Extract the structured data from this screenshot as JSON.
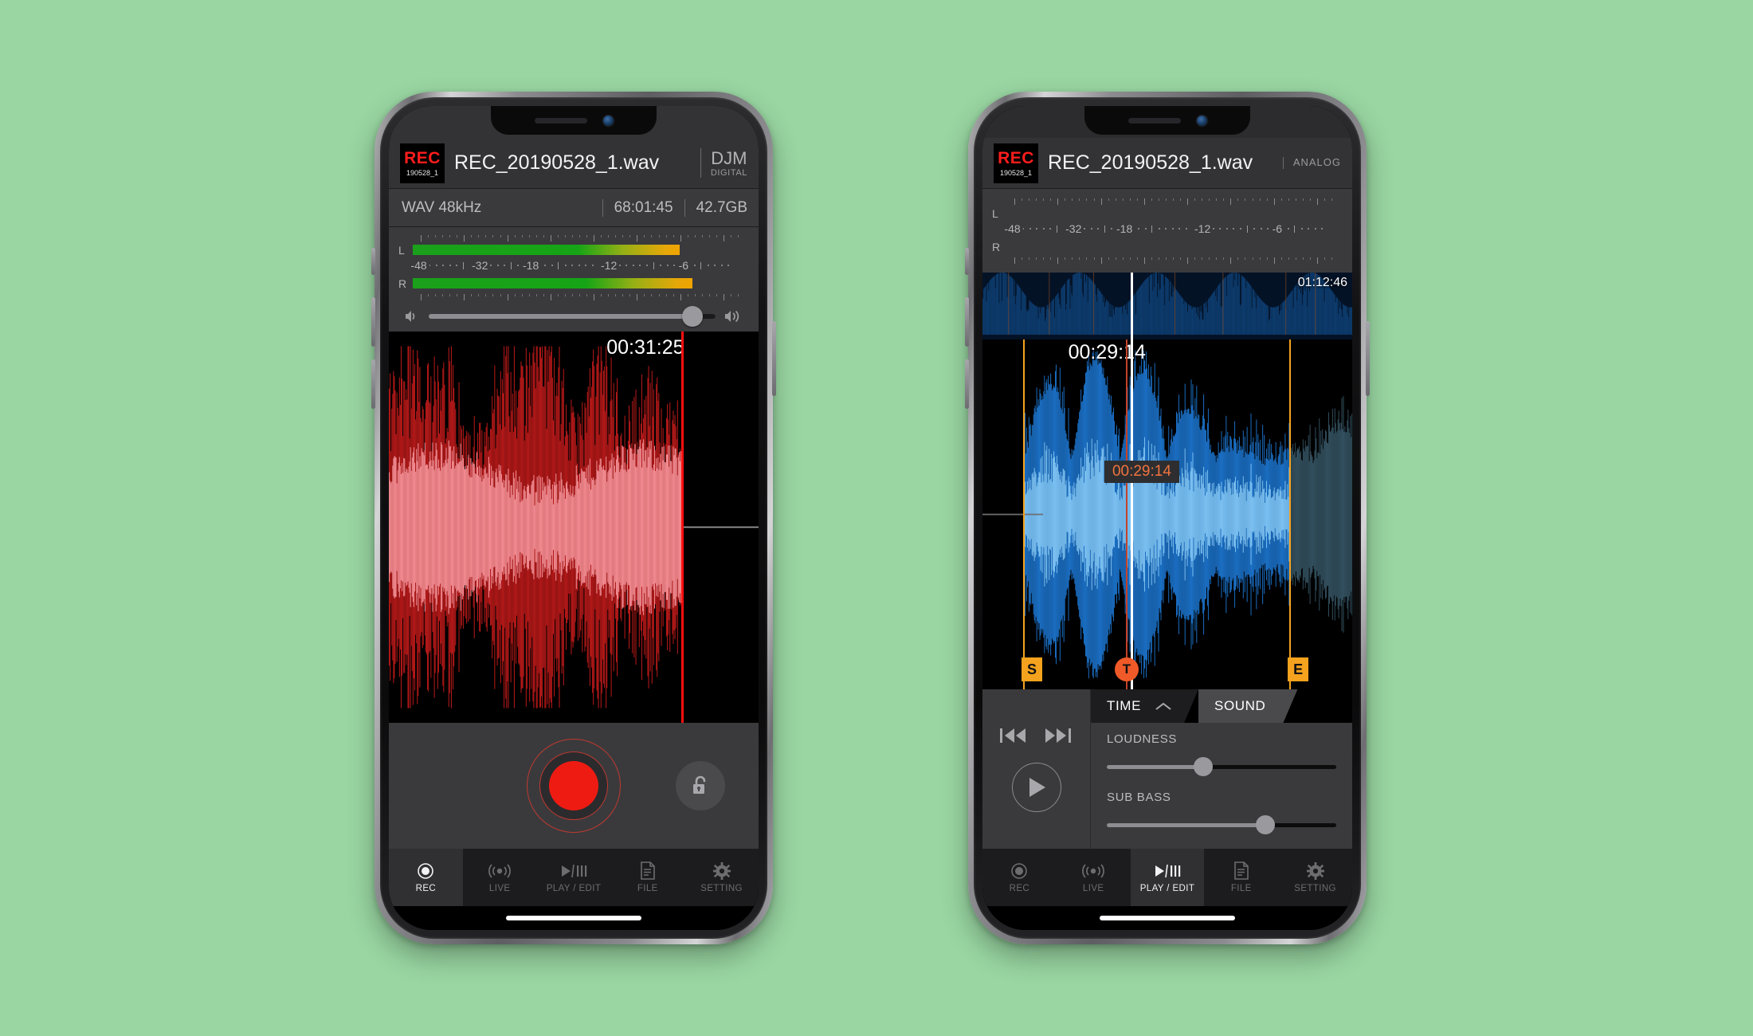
{
  "background_color": "#99d6a2",
  "phones": [
    {
      "id": "rec-screen",
      "mode_tag": {
        "line1": "DJM",
        "line2": "DIGITAL"
      },
      "badge": {
        "title": "REC",
        "subtitle": "190528_1"
      },
      "filename": "REC_20190528_1.wav",
      "info": {
        "format": "WAV 48kHz",
        "remaining": "68:01:45",
        "storage": "42.7GB"
      },
      "meters": {
        "left_label": "L",
        "right_label": "R",
        "scale_labels": [
          "-48",
          "-32",
          "-18",
          "-12",
          "-6"
        ],
        "left_level_pct": 82,
        "right_level_pct": 86
      },
      "volume": {
        "value_pct": 92,
        "icon_left": "speaker-low-icon",
        "icon_right": "speaker-high-icon"
      },
      "waveform": {
        "color_peak": "#b01818",
        "color_body": "#ef8a90",
        "playhead_color": "#ff0f0f",
        "current_time": "00:31:25",
        "position_pct": 79
      },
      "record": {
        "button_label": "record-button",
        "lock_label": "unlock-button"
      },
      "nav": {
        "items": [
          {
            "label": "REC",
            "icon": "record-circle-icon",
            "active": true
          },
          {
            "label": "LIVE",
            "icon": "broadcast-icon",
            "active": false
          },
          {
            "label": "PLAY / EDIT",
            "icon": "play-edit-icon",
            "active": false
          },
          {
            "label": "FILE",
            "icon": "document-icon",
            "active": false
          },
          {
            "label": "SETTING",
            "icon": "gear-icon",
            "active": false
          }
        ]
      }
    },
    {
      "id": "play-edit-screen",
      "mode_tag": {
        "line1": "ANALOG",
        "line2": ""
      },
      "badge": {
        "title": "REC",
        "subtitle": "190528_1"
      },
      "filename": "REC_20190528_1.wav",
      "meters": {
        "left_label": "L",
        "right_label": "R",
        "scale_labels": [
          "-48",
          "-32",
          "-18",
          "-12",
          "-6"
        ],
        "left_level_pct": 0,
        "right_level_pct": 0
      },
      "overview": {
        "total_time": "01:12:46",
        "playhead_pct": 40,
        "color": "#0d3c6e"
      },
      "waveform": {
        "color_peak": "#1b6fc4",
        "color_body": "#7cc0f0",
        "color_muted": "#33505f",
        "playhead_color": "#ffffff",
        "current_time": "00:29:14",
        "position_pct": 40,
        "tooltip_time": "00:29:14"
      },
      "markers": [
        {
          "id": "start-marker",
          "label": "S",
          "type": "flag",
          "position_pct": 11
        },
        {
          "id": "t-marker",
          "label": "T",
          "type": "circle",
          "position_pct": 39
        },
        {
          "id": "end-marker",
          "label": "E",
          "type": "flag",
          "position_pct": 83
        }
      ],
      "transport": {
        "skip_back": "skip-back-icon",
        "skip_forward": "skip-forward-icon",
        "play": "play-icon"
      },
      "fx_tabs": [
        {
          "label": "TIME",
          "active": false,
          "icon": "chevron-up-icon"
        },
        {
          "label": "SOUND",
          "active": true,
          "icon": ""
        }
      ],
      "fx_controls": [
        {
          "label": "LOUDNESS",
          "value_pct": 42
        },
        {
          "label": "SUB BASS",
          "value_pct": 69
        }
      ],
      "nav": {
        "items": [
          {
            "label": "REC",
            "icon": "record-circle-icon",
            "active": false
          },
          {
            "label": "LIVE",
            "icon": "broadcast-icon",
            "active": false
          },
          {
            "label": "PLAY / EDIT",
            "icon": "play-edit-icon",
            "active": true
          },
          {
            "label": "FILE",
            "icon": "document-icon",
            "active": false
          },
          {
            "label": "SETTING",
            "icon": "gear-icon",
            "active": false
          }
        ]
      }
    }
  ]
}
